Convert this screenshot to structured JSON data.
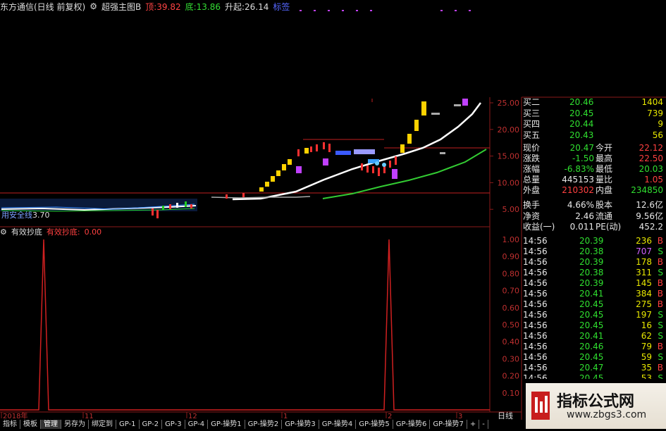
{
  "title_bar": {
    "stock_name": "东方通信(日线 前复权)",
    "indicator_name": "超强主图B",
    "top_label": "顶:",
    "top_value": "39.82",
    "bottom_label": "底:",
    "bottom_value": "13.86",
    "up_label": "升起:",
    "up_value": "26.14",
    "blue_text": "标签"
  },
  "main_chart": {
    "price_axis": [
      "25.00",
      "20.00",
      "15.00",
      "10.00",
      "5.00"
    ],
    "left_label": "用安全线",
    "left_value": "3.70",
    "price_labels": [
      "黑",
      "点",
      "顶",
      "底"
    ]
  },
  "sub_chart": {
    "name": "有效抄底",
    "series_label": "有效抄底:",
    "series_value": "0.00",
    "axis": [
      "1.00",
      "0.90",
      "0.80",
      "0.70",
      "0.60",
      "0.50",
      "0.40",
      "0.30",
      "0.20",
      "0.10"
    ]
  },
  "time_axis": {
    "labels": [
      "2018年",
      "11",
      "12",
      "1",
      "2",
      "3"
    ],
    "period": "日线"
  },
  "order_book": [
    {
      "label": "买二",
      "price": "20.46",
      "vol": "1404"
    },
    {
      "label": "买三",
      "price": "20.45",
      "vol": "739"
    },
    {
      "label": "买四",
      "price": "20.44",
      "vol": "9"
    },
    {
      "label": "买五",
      "price": "20.43",
      "vol": "56"
    }
  ],
  "stats": [
    {
      "l1": "现价",
      "v1": "20.47",
      "l2": "今开",
      "v2": "22.12",
      "c1": "green",
      "c2": "red"
    },
    {
      "l1": "涨跌",
      "v1": "-1.50",
      "l2": "最高",
      "v2": "22.50",
      "c1": "green",
      "c2": "red"
    },
    {
      "l1": "涨幅",
      "v1": "-6.83%",
      "l2": "最低",
      "v2": "20.03",
      "c1": "green",
      "c2": "green"
    },
    {
      "l1": "总量",
      "v1": "445153",
      "l2": "量比",
      "v2": "1.05",
      "c1": "white",
      "c2": "red"
    },
    {
      "l1": "外盘",
      "v1": "210302",
      "l2": "内盘",
      "v2": "234850",
      "c1": "red",
      "c2": "green"
    }
  ],
  "stats2": [
    {
      "l1": "换手",
      "v1": "4.66%",
      "l2": "股本",
      "v2": "12.6亿"
    },
    {
      "l1": "净资",
      "v1": "2.46",
      "l2": "流通",
      "v2": "9.56亿"
    },
    {
      "l1": "收益(一)",
      "v1": "0.011",
      "l2": "PE(动)",
      "v2": "452.2"
    }
  ],
  "ticks": [
    {
      "time": "14:56",
      "price": "20.39",
      "vol": "236",
      "side": "B"
    },
    {
      "time": "14:56",
      "price": "20.38",
      "vol": "707",
      "side": "S"
    },
    {
      "time": "14:56",
      "price": "20.39",
      "vol": "178",
      "side": "B"
    },
    {
      "time": "14:56",
      "price": "20.38",
      "vol": "311",
      "side": "S"
    },
    {
      "time": "14:56",
      "price": "20.39",
      "vol": "145",
      "side": "B"
    },
    {
      "time": "14:56",
      "price": "20.41",
      "vol": "384",
      "side": "B"
    },
    {
      "time": "14:56",
      "price": "20.45",
      "vol": "275",
      "side": "B"
    },
    {
      "time": "14:56",
      "price": "20.45",
      "vol": "197",
      "side": "S"
    },
    {
      "time": "14:56",
      "price": "20.45",
      "vol": "16",
      "side": "S"
    },
    {
      "time": "14:56",
      "price": "20.41",
      "vol": "62",
      "side": "S"
    },
    {
      "time": "14:56",
      "price": "20.46",
      "vol": "79",
      "side": "B"
    },
    {
      "time": "14:56",
      "price": "20.45",
      "vol": "59",
      "side": "S"
    },
    {
      "time": "14:56",
      "price": "20.47",
      "vol": "35",
      "side": "B"
    },
    {
      "time": "14:56",
      "price": "20.45",
      "vol": "53",
      "side": "S"
    }
  ],
  "tabs": [
    "指标",
    "模板",
    "管理",
    "另存为",
    "绑定到",
    "GP-1",
    "GP-2",
    "GP-3",
    "GP-4",
    "GP-操势1",
    "GP-操势2",
    "GP-操势3",
    "GP-操势4",
    "GP-操势5",
    "GP-操势6",
    "GP-操势7"
  ],
  "tab_plus": "+",
  "tab_minus": "-",
  "watermark": {
    "title": "指标公式网",
    "url": "www.zbgs3.com"
  },
  "colors": {
    "red": "#ff4040",
    "green": "#30e030",
    "grid_red": "#8b1a1a",
    "yellow": "#ffd200"
  }
}
